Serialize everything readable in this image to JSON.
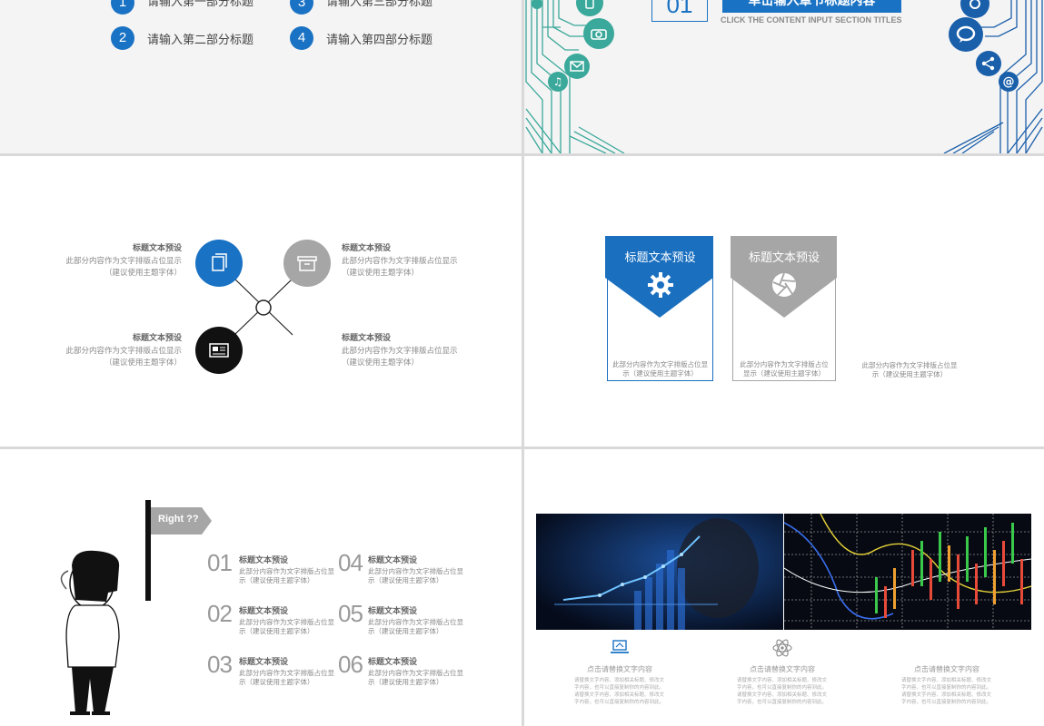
{
  "slide1": {
    "items": [
      {
        "num": "1",
        "label": "请输入第一部分标题"
      },
      {
        "num": "3",
        "label": "请输入第三部分标题"
      },
      {
        "num": "2",
        "label": "请输入第二部分标题"
      },
      {
        "num": "4",
        "label": "请输入第四部分标题"
      }
    ]
  },
  "slide2": {
    "section_num": "01",
    "section_title": "单击输入章节标题内容",
    "subtitle": "CLICK THE CONTENT INPUT SECTION TITLES"
  },
  "slide3": {
    "blocks": [
      {
        "title": "标题文本预设",
        "text": "此部分内容作为文字排版占位显示（建议使用主题字体）"
      },
      {
        "title": "标题文本预设",
        "text": "此部分内容作为文字排版占位显示（建议使用主题字体）"
      },
      {
        "title": "标题文本预设",
        "text": "此部分内容作为文字排版占位显示（建议使用主题字体）"
      },
      {
        "title": "标题文本预设",
        "text": "此部分内容作为文字排版占位显示（建议使用主题字体）"
      }
    ]
  },
  "slide4": {
    "cards": [
      {
        "title": "标题文本预设",
        "text": "此部分内容作为文字排版占位显示（建议使用主题字体）",
        "color": "#1a6fbf"
      },
      {
        "title": "标题文本预设",
        "text": "此部分内容作为文字排版占位显示（建议使用主题字体）",
        "color": "#a6a6a6"
      }
    ],
    "extra_text": "此部分内容作为文字排版占位显示（建议使用主题字体）"
  },
  "slide5": {
    "flag_label": "Right ??",
    "items": [
      {
        "num": "01",
        "title": "标题文本预设",
        "text": "此部分内容作为文字排版占位显示（建议使用主题字体）"
      },
      {
        "num": "04",
        "title": "标题文本预设",
        "text": "此部分内容作为文字排版占位显示（建议使用主题字体）"
      },
      {
        "num": "02",
        "title": "标题文本预设",
        "text": "此部分内容作为文字排版占位显示（建议使用主题字体）"
      },
      {
        "num": "05",
        "title": "标题文本预设",
        "text": "此部分内容作为文字排版占位显示（建议使用主题字体）"
      },
      {
        "num": "03",
        "title": "标题文本预设",
        "text": "此部分内容作为文字排版占位显示（建议使用主题字体）"
      },
      {
        "num": "06",
        "title": "标题文本预设",
        "text": "此部分内容作为文字排版占位显示（建议使用主题字体）"
      }
    ]
  },
  "slide6": {
    "columns": [
      {
        "title": "点击请替换文字内容",
        "text": "请替换文字内容、添加相关标题、修改文字内容，也可以直接复制你的内容到此。请替换文字内容、添加相关标题、修改文字内容，也可以直接复制你的内容到此。"
      },
      {
        "title": "点击请替换文字内容",
        "text": "请替换文字内容、添加相关标题、修改文字内容，也可以直接复制你的内容到此。请替换文字内容、添加相关标题、修改文字内容，也可以直接复制你的内容到此。"
      },
      {
        "title": "点击请替换文字内容",
        "text": "请替换文字内容、添加相关标题、修改文字内容，也可以直接复制你的内容到此。请替换文字内容、添加相关标题、修改文字内容，也可以直接复制你的内容到此。"
      }
    ]
  },
  "colors": {
    "blue": "#1a72c4",
    "gray": "#a6a6a6",
    "teal": "#3aa89a",
    "dark": "#111111"
  }
}
